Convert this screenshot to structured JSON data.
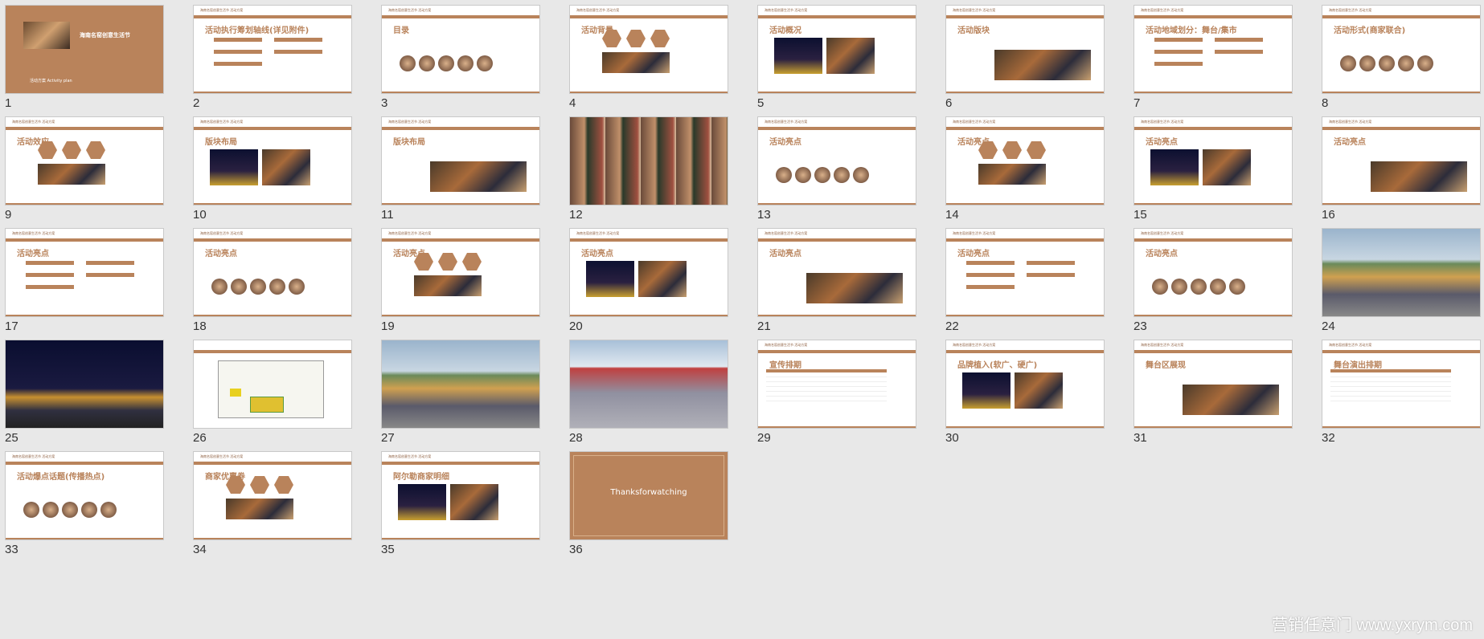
{
  "slides": [
    {
      "n": "1",
      "kind": "cover",
      "title": "海南名窑创意生活节",
      "sub": "活动方案 Activity plan"
    },
    {
      "n": "2",
      "kind": "content",
      "title": "活动执行筹划轴线(详见附件)"
    },
    {
      "n": "3",
      "kind": "content",
      "title": "目录"
    },
    {
      "n": "4",
      "kind": "content",
      "title": "活动背景"
    },
    {
      "n": "5",
      "kind": "content",
      "title": "活动概况"
    },
    {
      "n": "6",
      "kind": "content",
      "title": "活动版块"
    },
    {
      "n": "7",
      "kind": "content",
      "title": "活动地域划分：舞台/集市"
    },
    {
      "n": "8",
      "kind": "content",
      "title": "活动形式(商家联合)"
    },
    {
      "n": "9",
      "kind": "content",
      "title": "活动效应"
    },
    {
      "n": "10",
      "kind": "content",
      "title": "版块布局"
    },
    {
      "n": "11",
      "kind": "content",
      "title": "版块布局"
    },
    {
      "n": "12",
      "kind": "collage",
      "title": ""
    },
    {
      "n": "13",
      "kind": "content",
      "title": "活动亮点"
    },
    {
      "n": "14",
      "kind": "content",
      "title": "活动亮点"
    },
    {
      "n": "15",
      "kind": "content",
      "title": "活动亮点"
    },
    {
      "n": "16",
      "kind": "content",
      "title": "活动亮点"
    },
    {
      "n": "17",
      "kind": "content",
      "title": "活动亮点"
    },
    {
      "n": "18",
      "kind": "content",
      "title": "活动亮点"
    },
    {
      "n": "19",
      "kind": "content",
      "title": "活动亮点"
    },
    {
      "n": "20",
      "kind": "content",
      "title": "活动亮点"
    },
    {
      "n": "21",
      "kind": "content",
      "title": "活动亮点"
    },
    {
      "n": "22",
      "kind": "content",
      "title": "活动亮点"
    },
    {
      "n": "23",
      "kind": "content",
      "title": "活动亮点"
    },
    {
      "n": "24",
      "kind": "render",
      "title": ""
    },
    {
      "n": "25",
      "kind": "render-night",
      "title": ""
    },
    {
      "n": "26",
      "kind": "plan",
      "title": ""
    },
    {
      "n": "27",
      "kind": "render",
      "title": ""
    },
    {
      "n": "28",
      "kind": "render-arch",
      "title": ""
    },
    {
      "n": "29",
      "kind": "table",
      "title": "宣传排期"
    },
    {
      "n": "30",
      "kind": "content",
      "title": "品牌植入(软广、硬广)"
    },
    {
      "n": "31",
      "kind": "content",
      "title": "舞台区展现"
    },
    {
      "n": "32",
      "kind": "table",
      "title": "舞台演出排期"
    },
    {
      "n": "33",
      "kind": "content",
      "title": "活动爆点话题(传播热点)"
    },
    {
      "n": "34",
      "kind": "content",
      "title": "商家优惠券"
    },
    {
      "n": "35",
      "kind": "content",
      "title": "阿尔勒商家明细"
    },
    {
      "n": "36",
      "kind": "end",
      "title": "Thanksforwatching"
    }
  ],
  "header_text": "海南名窑创意生活节  活动方案",
  "watermark": "营销任意门 www.yxrym.com",
  "colors": {
    "accent": "#b9835b",
    "background": "#e8e8e8"
  }
}
